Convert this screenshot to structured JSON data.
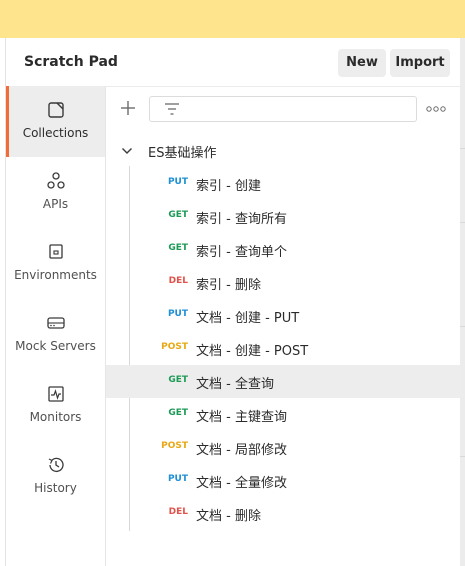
{
  "header": {
    "title": "Scratch Pad",
    "new_label": "New",
    "import_label": "Import"
  },
  "sidebar": {
    "items": [
      {
        "label": "Collections",
        "icon": "collections-icon",
        "active": true
      },
      {
        "label": "APIs",
        "icon": "apis-icon"
      },
      {
        "label": "Environments",
        "icon": "environments-icon"
      },
      {
        "label": "Mock Servers",
        "icon": "mock-servers-icon"
      },
      {
        "label": "Monitors",
        "icon": "monitors-icon"
      },
      {
        "label": "History",
        "icon": "history-icon"
      }
    ]
  },
  "collection": {
    "folder_name": "ES基础操作",
    "requests": [
      {
        "method": "PUT",
        "name": "索引 - 创建"
      },
      {
        "method": "GET",
        "name": "索引 - 查询所有"
      },
      {
        "method": "GET",
        "name": "索引 - 查询单个"
      },
      {
        "method": "DEL",
        "name": "索引 - 删除"
      },
      {
        "method": "PUT",
        "name": "文档 - 创建 - PUT"
      },
      {
        "method": "POST",
        "name": "文档 - 创建 - POST"
      },
      {
        "method": "GET",
        "name": "文档 - 全查询",
        "selected": true
      },
      {
        "method": "GET",
        "name": "文档 - 主键查询"
      },
      {
        "method": "POST",
        "name": "文档 - 局部修改"
      },
      {
        "method": "PUT",
        "name": "文档 - 全量修改"
      },
      {
        "method": "DEL",
        "name": "文档 - 删除"
      }
    ]
  },
  "colors": {
    "accent": "#f26b3a",
    "banner": "#fde48d",
    "PUT": "#1f8fd4",
    "GET": "#1e9a57",
    "DEL": "#e0524a",
    "POST": "#e8a813"
  }
}
